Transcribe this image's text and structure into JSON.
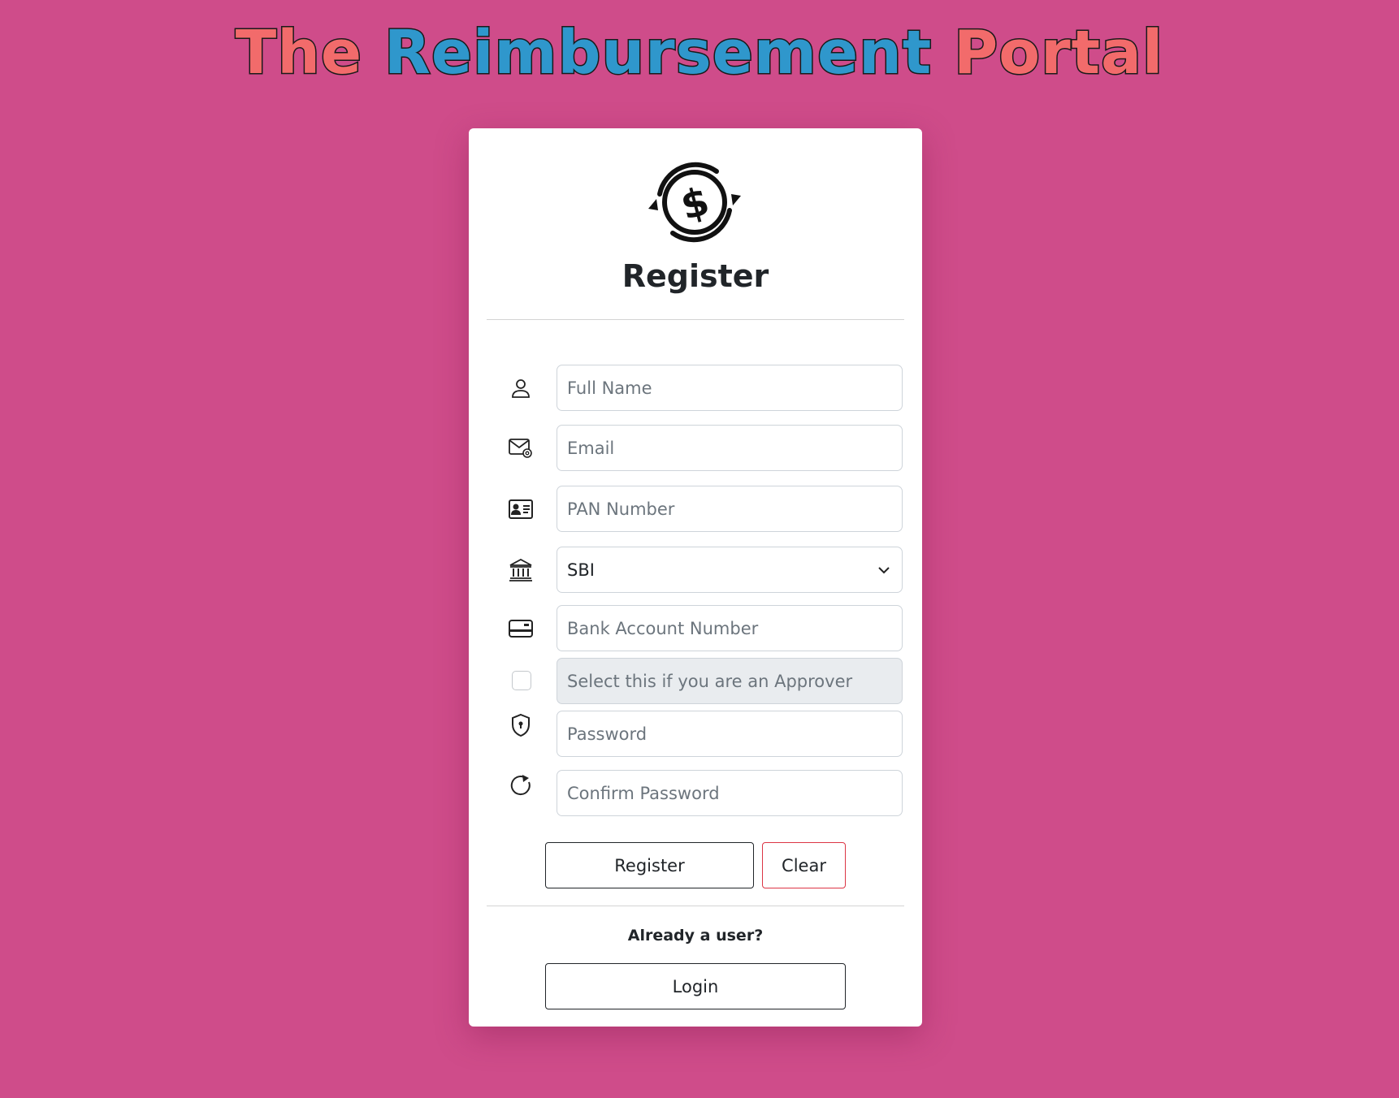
{
  "header": {
    "title_part1": "The",
    "title_part2": "Reimbursement",
    "title_part3": "Portal"
  },
  "form": {
    "title": "Register",
    "fields": {
      "full_name_placeholder": "Full Name",
      "email_placeholder": "Email",
      "pan_placeholder": "PAN Number",
      "bank_selected": "SBI",
      "account_placeholder": "Bank Account Number",
      "approver_label": "Select this if you are an Approver",
      "password_placeholder": "Password",
      "confirm_password_placeholder": "Confirm Password"
    },
    "approver_checked": false,
    "register_label": "Register",
    "clear_label": "Clear",
    "already_user_text": "Already a user?",
    "login_label": "Login"
  },
  "icons": [
    "dollar-cycle-logo",
    "person-icon",
    "envelope-at-icon",
    "id-card-icon",
    "bank-icon",
    "credit-card-icon",
    "shield-lock-icon",
    "refresh-icon",
    "chevron-down-icon"
  ],
  "colors": {
    "background": "#cf4c8a",
    "title_red": "#f26b6b",
    "title_blue": "#2f97cc",
    "clear_border": "#dc3545"
  }
}
